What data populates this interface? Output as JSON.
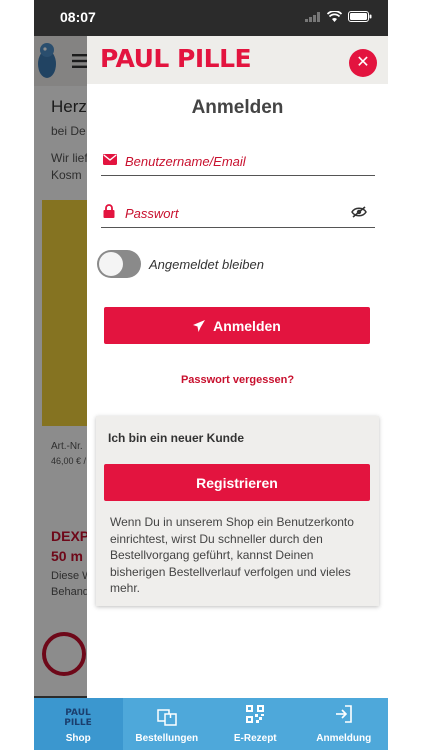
{
  "status_bar": {
    "time": "08:07"
  },
  "background_page": {
    "heading": "Herz",
    "line1": "bei De",
    "line2": "Wir lief",
    "line3": "Kosm",
    "art_nr": "Art.-Nr.",
    "price": "46,00 € /",
    "product_name": "DEXP",
    "dosage": "50 m",
    "desc1": "Diese W",
    "desc2": "Behand"
  },
  "login_sheet": {
    "logo_text": "PAUL PILLE",
    "close_icon": "close-icon",
    "title": "Anmelden",
    "username": {
      "placeholder": "Benutzername/Email",
      "value": "",
      "icon": "envelope-icon"
    },
    "password": {
      "placeholder": "Passwort",
      "value": "",
      "icon": "lock-icon",
      "toggle_icon": "eye-slash-icon"
    },
    "remember_me": {
      "label": "Angemeldet bleiben",
      "checked": false
    },
    "login_button": {
      "label": "Anmelden",
      "icon": "paper-plane-icon"
    },
    "forgot_password": "Passwort vergessen?",
    "new_customer": {
      "title": "Ich bin ein neuer Kunde",
      "register_button": "Registrieren",
      "text": "Wenn Du in unserem Shop ein Benutzerkonto einrichtest, wirst Du schneller durch den Bestellvorgang geführt, kannst Deinen bisherigen Bestellverlauf verfolgen und vieles mehr."
    }
  },
  "tabbar": {
    "tabs": [
      {
        "label": "Shop",
        "icon": "paul-pille-logo-icon",
        "active": true
      },
      {
        "label": "Bestellungen",
        "icon": "boxes-icon",
        "active": false
      },
      {
        "label": "E-Rezept",
        "icon": "qr-code-icon",
        "active": false
      },
      {
        "label": "Anmeldung",
        "icon": "sign-in-icon",
        "active": false
      }
    ]
  },
  "colors": {
    "brand": "#e3143f",
    "tabbar": "#4ea8da",
    "card": "#efeeec"
  }
}
